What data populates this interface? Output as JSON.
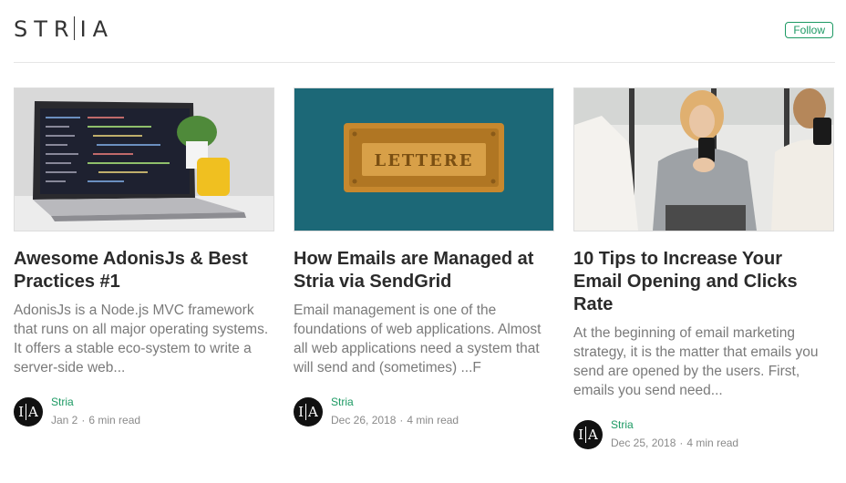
{
  "header": {
    "logo_left": "STR",
    "logo_right": "IA",
    "follow_label": "Follow"
  },
  "colors": {
    "accent": "#1c9963",
    "muted_text": "#7a7a7a",
    "divider": "#e6e6e6"
  },
  "cards": [
    {
      "title": "Awesome AdonisJs & Best Practices #1",
      "excerpt": "AdonisJs is a Node.js MVC framework that runs on all major operating systems. It offers a stable eco-system to write a server-side web...",
      "author": "Stria",
      "date": "Jan 2",
      "read_time": "6 min read",
      "image": "laptop-on-desk"
    },
    {
      "title": "How Emails are Managed at Stria via SendGrid",
      "excerpt": "Email management is one of the foundations of web applications. Almost all web applications need a system that will send and (sometimes) ...F",
      "author": "Stria",
      "date": "Dec 26, 2018",
      "read_time": "4 min read",
      "image": "lettere-mail-slot",
      "plate_text": "LETTERE"
    },
    {
      "title": "10 Tips to Increase Your Email Opening and Clicks Rate",
      "excerpt": "At the beginning of email marketing strategy, it is the matter that emails you send are opened by the users. First, emails you send need...",
      "author": "Stria",
      "date": "Dec 25, 2018",
      "read_time": "4 min read",
      "image": "people-with-phones"
    }
  ],
  "avatar": {
    "left": "I",
    "right": "A"
  },
  "separator": "·"
}
